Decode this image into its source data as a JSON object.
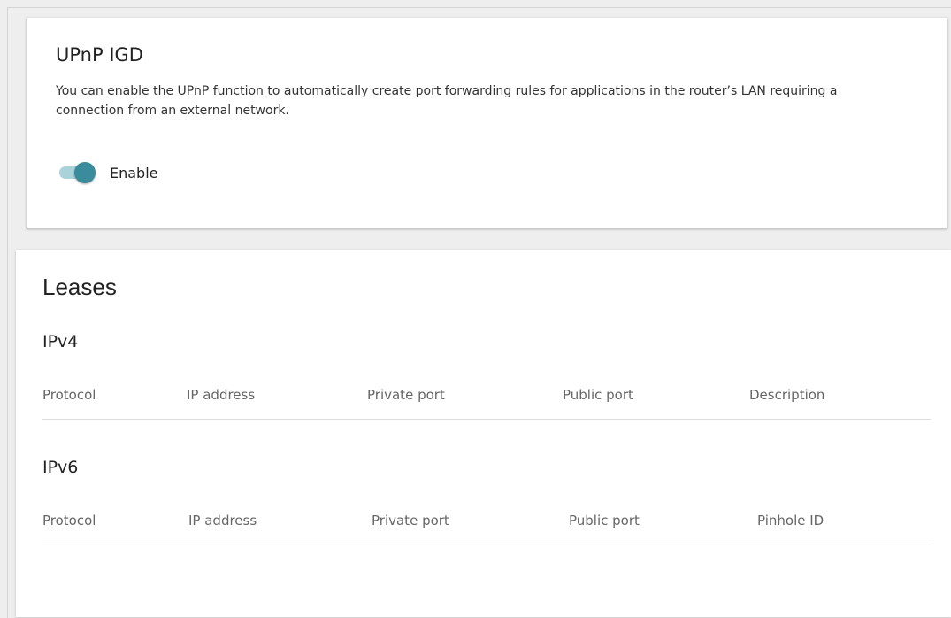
{
  "upnp": {
    "title": "UPnP IGD",
    "description": "You can enable the UPnP function to automatically create port forwarding rules for applications in the router’s LAN requiring a connection from an external network.",
    "enable_label": "Enable",
    "enabled": true
  },
  "leases": {
    "title": "Leases",
    "ipv4": {
      "title": "IPv4",
      "columns": [
        "Protocol",
        "IP address",
        "Private port",
        "Public port",
        "Description"
      ]
    },
    "ipv6": {
      "title": "IPv6",
      "columns": [
        "Protocol",
        "IP address",
        "Private port",
        "Public port",
        "Pinhole ID"
      ]
    }
  },
  "colors": {
    "toggle_knob": "#3a8b9c",
    "toggle_track": "#a9d3d8",
    "background": "#eeeeee"
  }
}
